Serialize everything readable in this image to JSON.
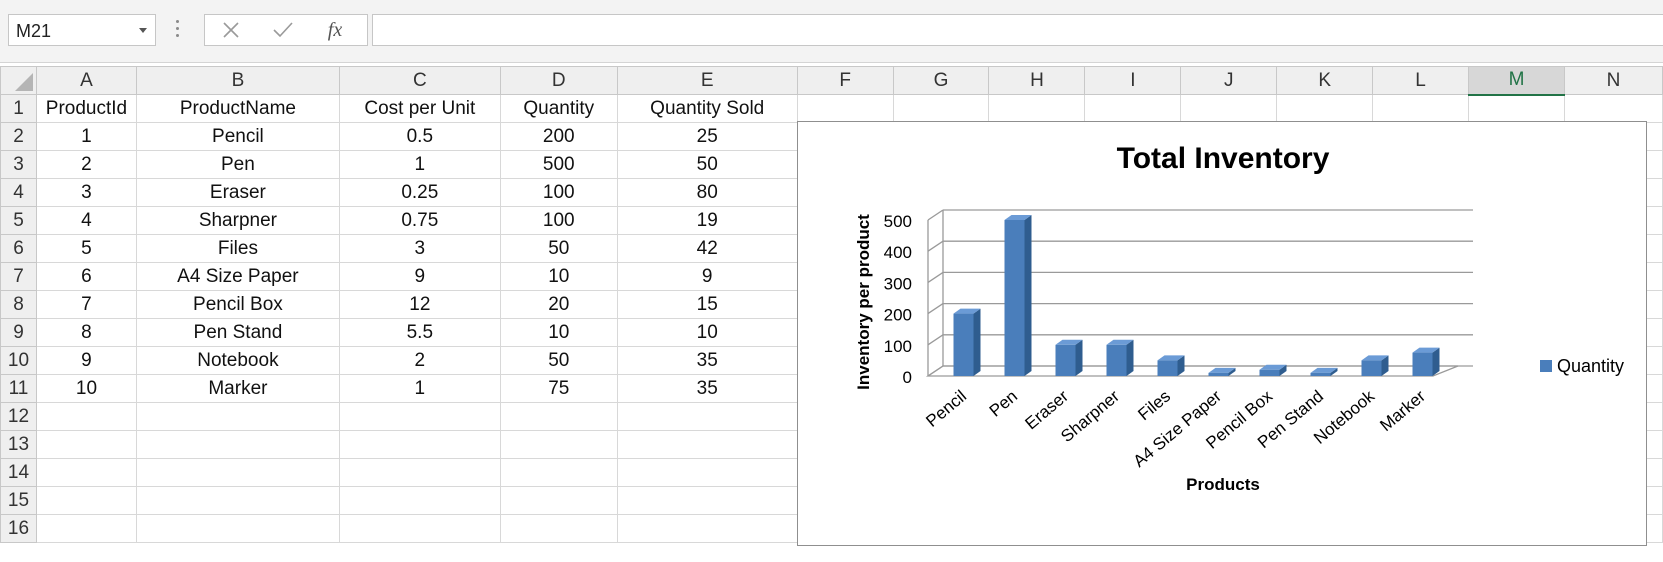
{
  "name_box": {
    "value": "M21"
  },
  "formula_bar": {
    "value": "",
    "fx_label": "fx"
  },
  "columns": [
    "A",
    "B",
    "C",
    "D",
    "E",
    "F",
    "G",
    "H",
    "I",
    "J",
    "K",
    "L",
    "M",
    "N"
  ],
  "selected_column": "M",
  "row_numbers": [
    "1",
    "2",
    "3",
    "4",
    "5",
    "6",
    "7",
    "8",
    "9",
    "10",
    "11",
    "12",
    "13",
    "14",
    "15",
    "16"
  ],
  "table": {
    "headers": [
      "ProductId",
      "ProductName",
      "Cost per Unit",
      "Quantity",
      "Quantity Sold"
    ],
    "rows": [
      [
        "1",
        "Pencil",
        "0.5",
        "200",
        "25"
      ],
      [
        "2",
        "Pen",
        "1",
        "500",
        "50"
      ],
      [
        "3",
        "Eraser",
        "0.25",
        "100",
        "80"
      ],
      [
        "4",
        "Sharpner",
        "0.75",
        "100",
        "19"
      ],
      [
        "5",
        "Files",
        "3",
        "50",
        "42"
      ],
      [
        "6",
        "A4 Size Paper",
        "9",
        "10",
        "9"
      ],
      [
        "7",
        "Pencil Box",
        "12",
        "20",
        "15"
      ],
      [
        "8",
        "Pen Stand",
        "5.5",
        "10",
        "10"
      ],
      [
        "9",
        "Notebook",
        "2",
        "50",
        "35"
      ],
      [
        "10",
        "Marker",
        "1",
        "75",
        "35"
      ]
    ]
  },
  "chart_data": {
    "type": "bar",
    "title": "Total Inventory",
    "xlabel": "Products",
    "ylabel": "Inventory per product",
    "categories": [
      "Pencil",
      "Pen",
      "Eraser",
      "Sharpner",
      "Files",
      "A4 Size Paper",
      "Pencil Box",
      "Pen Stand",
      "Notebook",
      "Marker"
    ],
    "series": [
      {
        "name": "Quantity",
        "values": [
          200,
          500,
          100,
          100,
          50,
          10,
          20,
          10,
          50,
          75
        ]
      }
    ],
    "ylim": [
      0,
      500
    ],
    "yticks": [
      "0",
      "100",
      "200",
      "300",
      "400",
      "500"
    ],
    "grid": true,
    "legend": "right",
    "colors": {
      "bar_front": "#4a7ebb",
      "bar_side": "#2f5d8f",
      "bar_top": "#6b9bd6"
    }
  }
}
